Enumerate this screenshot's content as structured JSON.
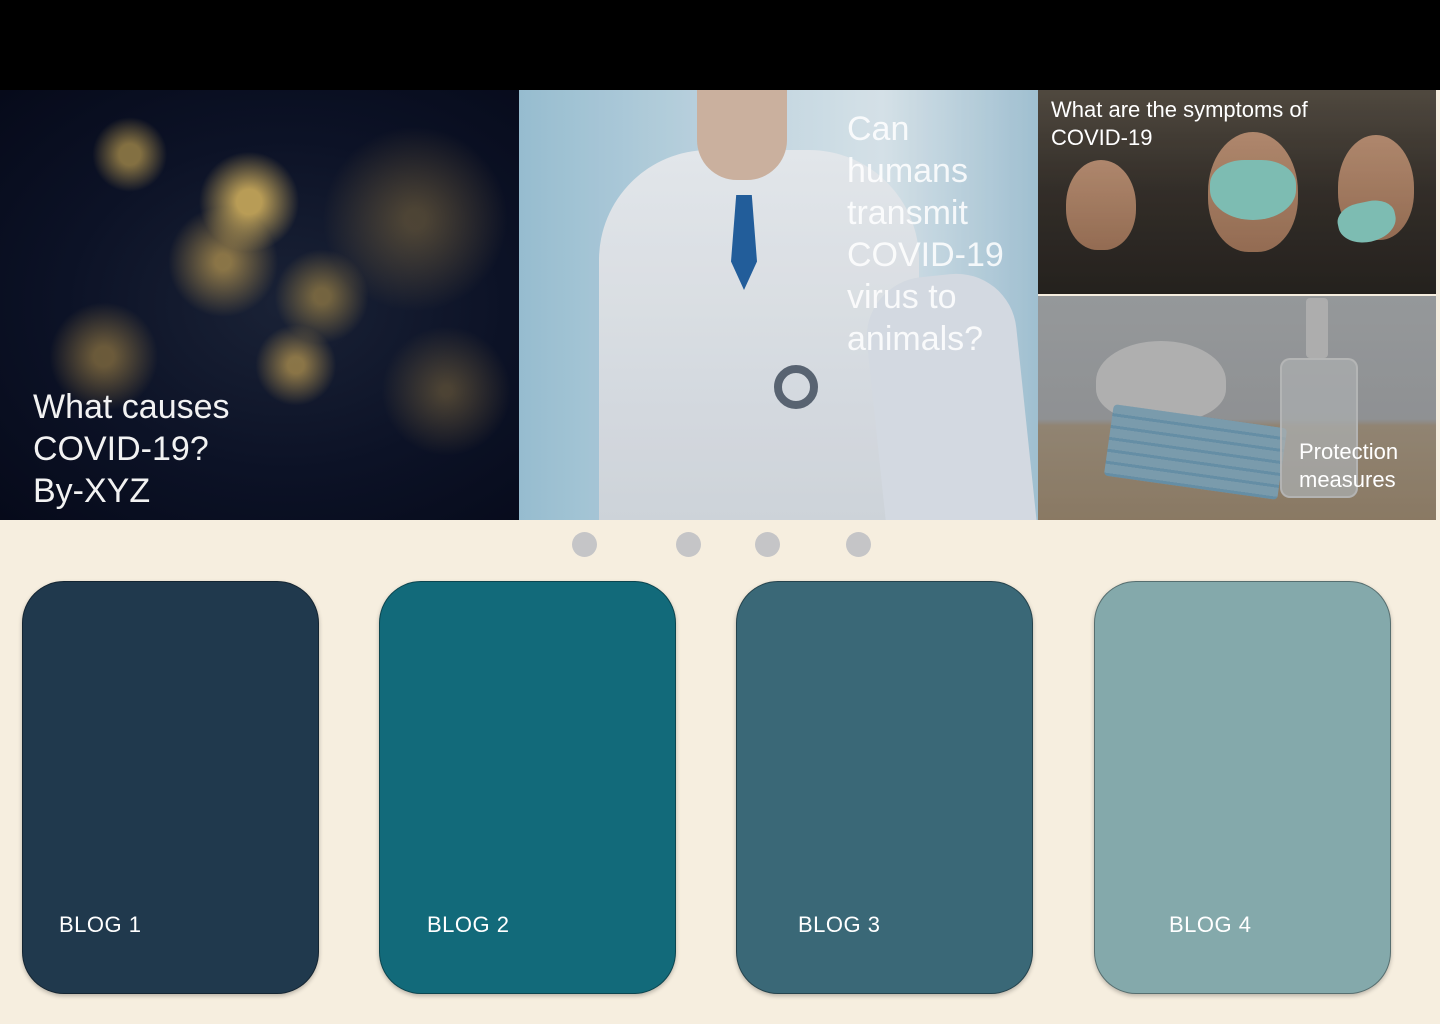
{
  "hero": {
    "cards": [
      {
        "caption_lines": [
          "What causes",
          "COVID-19?",
          "By-XYZ"
        ]
      },
      {
        "caption_lines": [
          "Can",
          "humans",
          "transmit",
          "COVID-19",
          "virus to",
          "animals?"
        ]
      },
      {
        "caption_lines": [
          "What are the symptoms of",
          "COVID-19"
        ]
      },
      {
        "caption_lines": [
          "Protection",
          "measures"
        ]
      }
    ]
  },
  "carousel": {
    "dot_count": 4,
    "dot_color": "#c5c5c7"
  },
  "blogs": [
    {
      "label": "BLOG 1",
      "color": "#20394d"
    },
    {
      "label": "BLOG 2",
      "color": "#126a7a"
    },
    {
      "label": "BLOG 3",
      "color": "#3a6877"
    },
    {
      "label": "BLOG 4",
      "color": "#84a9ab"
    }
  ],
  "colors": {
    "header": "#000000",
    "background": "#f6eedf"
  }
}
